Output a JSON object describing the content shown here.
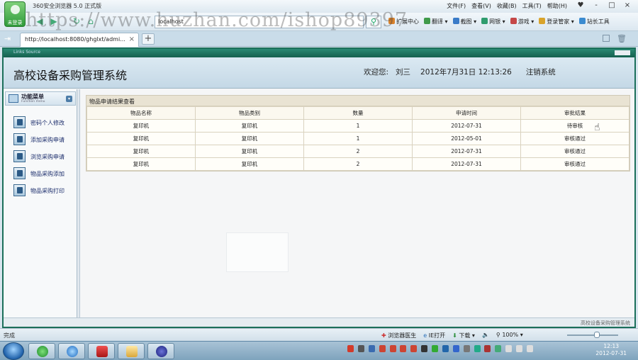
{
  "browser": {
    "logo_label": "未登录",
    "window_title": "360安全浏览器 5.0 正式版",
    "menu": [
      "文件(F)",
      "查看(V)",
      "收藏(B)",
      "工具(T)",
      "帮助(H)"
    ],
    "window_controls": [
      "-",
      "□",
      "×"
    ],
    "address_text": "localhost",
    "tab_title": "http://localhost:8080/ghglxt/admi...",
    "toolbar_items": [
      {
        "label": "扩展中心",
        "color": "#d9822b"
      },
      {
        "label": "翻译",
        "color": "#3f9a4a"
      },
      {
        "label": "截图",
        "color": "#3a7bc8"
      },
      {
        "label": "网银",
        "color": "#2f9c6e"
      },
      {
        "label": "游戏",
        "color": "#c54747"
      },
      {
        "label": "登录管家",
        "color": "#d9a32b"
      },
      {
        "label": "站长工具",
        "color": "#3b8bd0"
      }
    ],
    "status_text": "完成",
    "status_items": [
      "浏览器医生",
      "IE打开",
      "下载",
      "100%"
    ]
  },
  "watermark": "https://www.huzhan.com/ishop89397",
  "frame": {
    "top_text": "Links Source",
    "footer_text": "高校设备采购管理系统"
  },
  "banner": {
    "title": "高校设备采购管理系统",
    "welcome": "欢迎您:",
    "user": "刘三",
    "datetime": "2012年7月31日 12:13:26",
    "logout": "注销系统"
  },
  "sidebar": {
    "title": "功能菜单",
    "subtitle": "Function menu",
    "items": [
      {
        "label": "密码个人修改"
      },
      {
        "label": "添加采购申请"
      },
      {
        "label": "浏览采购申请"
      },
      {
        "label": "物品采购添加"
      },
      {
        "label": "物品采购打印"
      }
    ]
  },
  "panel": {
    "title": "物品申请结果查看",
    "columns": [
      "物品名称",
      "物品类别",
      "数量",
      "申请时间",
      "审批结果"
    ],
    "rows": [
      [
        "复印机",
        "复印机",
        "1",
        "2012-07-31",
        "待审核"
      ],
      [
        "复印机",
        "复印机",
        "1",
        "2012-05-01",
        "审核通过"
      ],
      [
        "复印机",
        "复印机",
        "2",
        "2012-07-31",
        "审核通过"
      ],
      [
        "复印机",
        "复印机",
        "2",
        "2012-07-31",
        "审核通过"
      ]
    ]
  },
  "clock": {
    "time": "12:13",
    "date": "2012-07-31"
  }
}
